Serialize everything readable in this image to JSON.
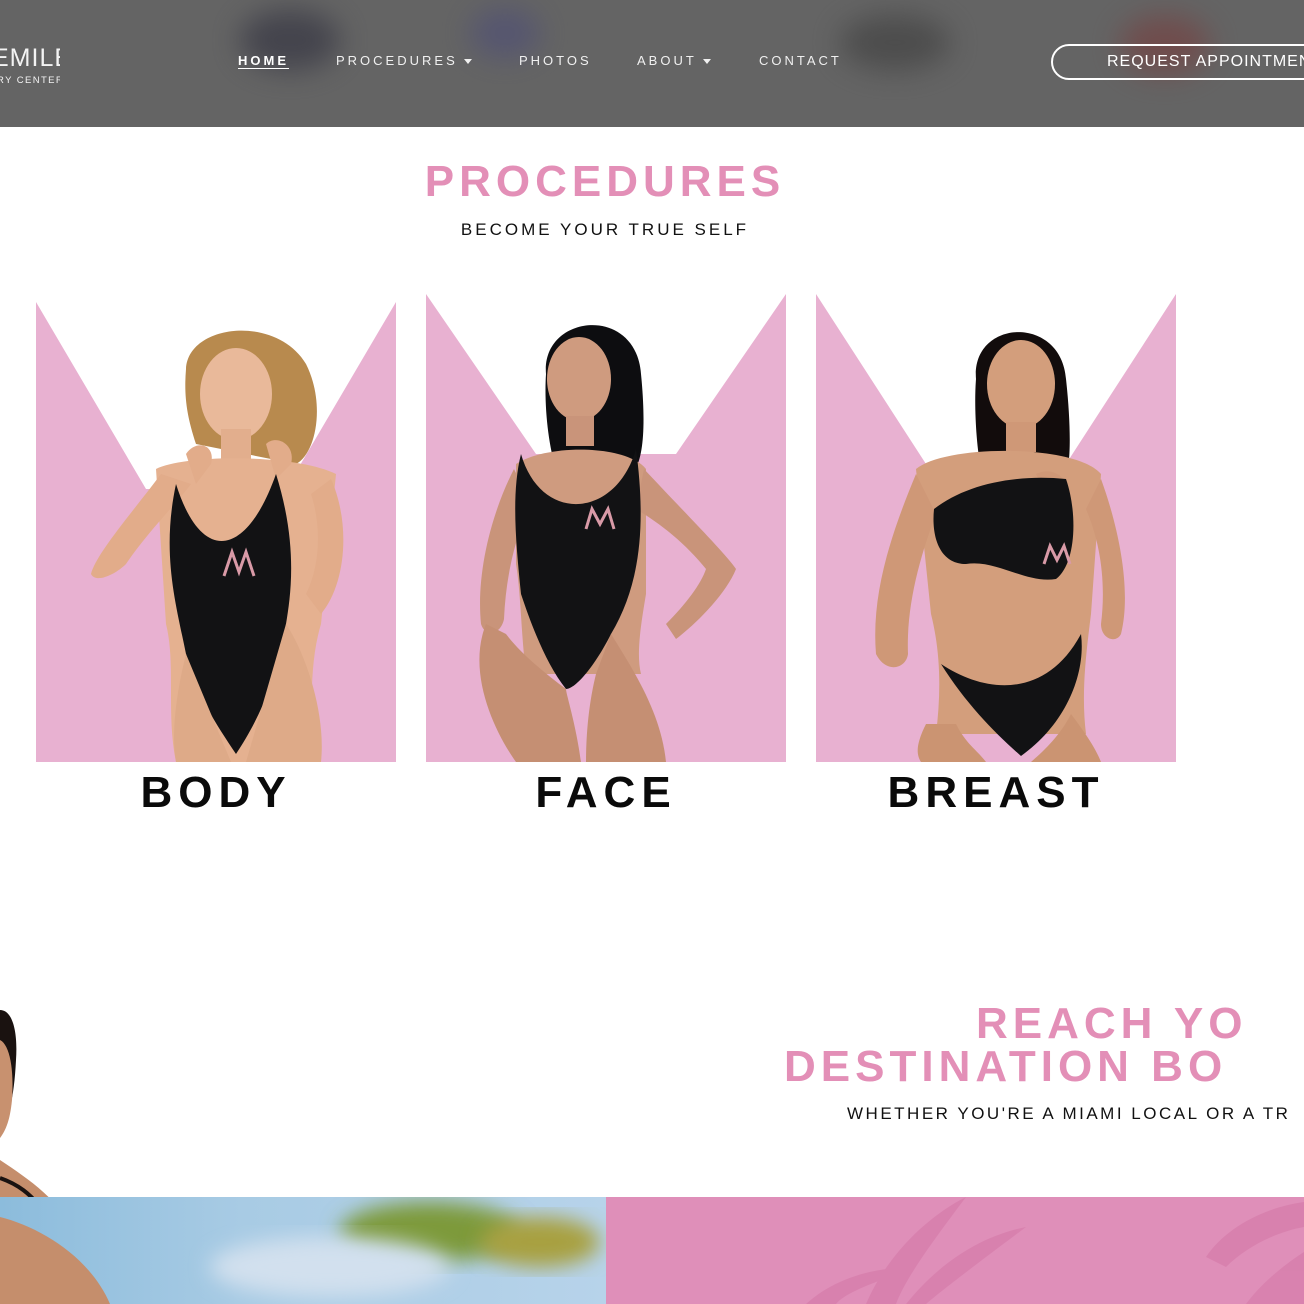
{
  "brand": {
    "logo_main": "EMILE",
    "logo_sub": "RY CENTER"
  },
  "nav": {
    "items": [
      {
        "label": "HOME",
        "active": true,
        "dropdown": false
      },
      {
        "label": "PROCEDURES",
        "active": false,
        "dropdown": true
      },
      {
        "label": "PHOTOS",
        "active": false,
        "dropdown": false
      },
      {
        "label": "ABOUT",
        "active": false,
        "dropdown": true
      },
      {
        "label": "CONTACT",
        "active": false,
        "dropdown": false
      }
    ],
    "cta_label": "REQUEST APPOINTMENT"
  },
  "procedures": {
    "title": "PROCEDURES",
    "subtitle": "BECOME YOUR TRUE SELF",
    "cards": [
      {
        "label": "BODY"
      },
      {
        "label": "FACE"
      },
      {
        "label": "BREAST"
      }
    ]
  },
  "reach": {
    "title_line1": "REACH YO",
    "title_line2": "DESTINATION BO",
    "subtitle": "WHETHER YOU'RE A MIAMI LOCAL OR A TR"
  },
  "colors": {
    "accent_pink": "#e38fb7",
    "card_pink": "#e8b1d1",
    "header_bg": "#646464",
    "banner_pink": "#df8fb9"
  }
}
